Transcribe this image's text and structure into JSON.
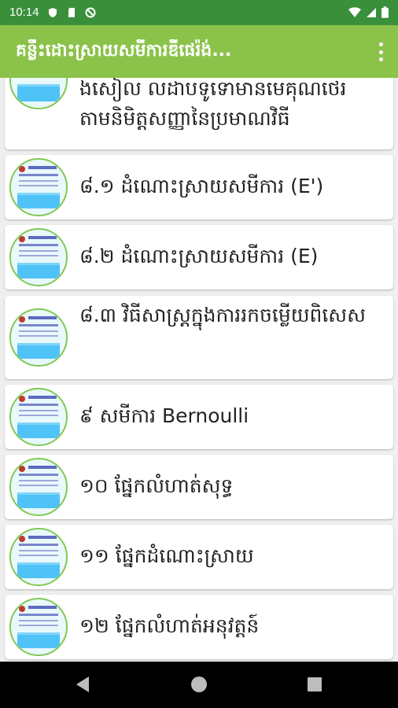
{
  "status_bar": {
    "time": "10:14",
    "icons_left": [
      "shield-icon",
      "sd-card-icon",
      "no-sync-icon"
    ],
    "icons_right": [
      "wifi-icon",
      "signal-icon",
      "battery-icon"
    ]
  },
  "app_bar": {
    "title": "គន្លឹះដោះស្រាយសមីការឌីផេរ៉ង់...",
    "overflow_icon": "more-vert-icon",
    "color": "#8bc34a"
  },
  "list": {
    "items": [
      {
        "label": "ងសៀល លដាបទូទោមានមេគុណថេរ តាមនិមិត្តសញ្ញានៃប្រមាណវិធី"
      },
      {
        "label": "៨.១ ដំណោះស្រាយសមីការ (E')"
      },
      {
        "label": "៨.២ ដំណោះស្រាយសមីការ (E)"
      },
      {
        "label": "៨.៣ វិធីសាស្ត្រក្នុងការរកចម្លើយពិសេស"
      },
      {
        "label": "៩ សមីការ Bernoulli"
      },
      {
        "label": "១០ ផ្នែកលំហាត់សុទ្ធ"
      },
      {
        "label": "១១ ផ្នែកដំណោះស្រាយ"
      },
      {
        "label": "១២ ផ្នែកលំហាត់អនុវត្តន៍"
      }
    ]
  },
  "nav_bar": {
    "back_icon": "back-icon",
    "home_icon": "home-icon",
    "recents_icon": "recents-icon"
  }
}
